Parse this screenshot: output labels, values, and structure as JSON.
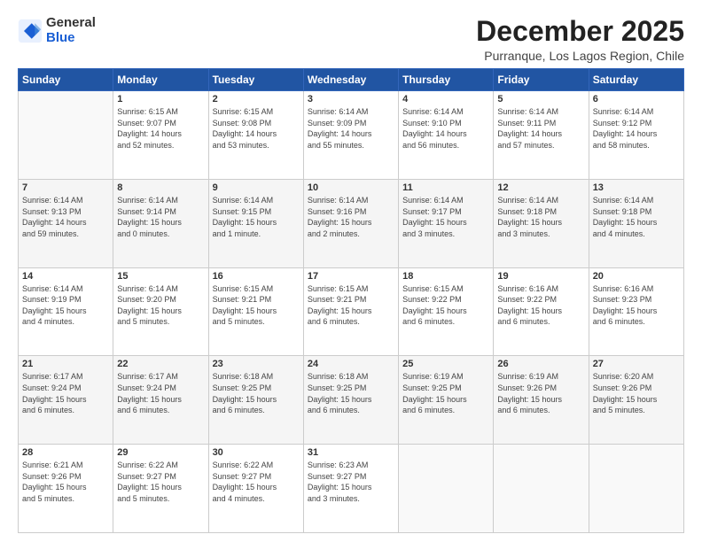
{
  "logo": {
    "general": "General",
    "blue": "Blue"
  },
  "header": {
    "month": "December 2025",
    "location": "Purranque, Los Lagos Region, Chile"
  },
  "weekdays": [
    "Sunday",
    "Monday",
    "Tuesday",
    "Wednesday",
    "Thursday",
    "Friday",
    "Saturday"
  ],
  "weeks": [
    [
      {
        "day": "",
        "detail": ""
      },
      {
        "day": "1",
        "detail": "Sunrise: 6:15 AM\nSunset: 9:07 PM\nDaylight: 14 hours\nand 52 minutes."
      },
      {
        "day": "2",
        "detail": "Sunrise: 6:15 AM\nSunset: 9:08 PM\nDaylight: 14 hours\nand 53 minutes."
      },
      {
        "day": "3",
        "detail": "Sunrise: 6:14 AM\nSunset: 9:09 PM\nDaylight: 14 hours\nand 55 minutes."
      },
      {
        "day": "4",
        "detail": "Sunrise: 6:14 AM\nSunset: 9:10 PM\nDaylight: 14 hours\nand 56 minutes."
      },
      {
        "day": "5",
        "detail": "Sunrise: 6:14 AM\nSunset: 9:11 PM\nDaylight: 14 hours\nand 57 minutes."
      },
      {
        "day": "6",
        "detail": "Sunrise: 6:14 AM\nSunset: 9:12 PM\nDaylight: 14 hours\nand 58 minutes."
      }
    ],
    [
      {
        "day": "7",
        "detail": "Sunrise: 6:14 AM\nSunset: 9:13 PM\nDaylight: 14 hours\nand 59 minutes."
      },
      {
        "day": "8",
        "detail": "Sunrise: 6:14 AM\nSunset: 9:14 PM\nDaylight: 15 hours\nand 0 minutes."
      },
      {
        "day": "9",
        "detail": "Sunrise: 6:14 AM\nSunset: 9:15 PM\nDaylight: 15 hours\nand 1 minute."
      },
      {
        "day": "10",
        "detail": "Sunrise: 6:14 AM\nSunset: 9:16 PM\nDaylight: 15 hours\nand 2 minutes."
      },
      {
        "day": "11",
        "detail": "Sunrise: 6:14 AM\nSunset: 9:17 PM\nDaylight: 15 hours\nand 3 minutes."
      },
      {
        "day": "12",
        "detail": "Sunrise: 6:14 AM\nSunset: 9:18 PM\nDaylight: 15 hours\nand 3 minutes."
      },
      {
        "day": "13",
        "detail": "Sunrise: 6:14 AM\nSunset: 9:18 PM\nDaylight: 15 hours\nand 4 minutes."
      }
    ],
    [
      {
        "day": "14",
        "detail": "Sunrise: 6:14 AM\nSunset: 9:19 PM\nDaylight: 15 hours\nand 4 minutes."
      },
      {
        "day": "15",
        "detail": "Sunrise: 6:14 AM\nSunset: 9:20 PM\nDaylight: 15 hours\nand 5 minutes."
      },
      {
        "day": "16",
        "detail": "Sunrise: 6:15 AM\nSunset: 9:21 PM\nDaylight: 15 hours\nand 5 minutes."
      },
      {
        "day": "17",
        "detail": "Sunrise: 6:15 AM\nSunset: 9:21 PM\nDaylight: 15 hours\nand 6 minutes."
      },
      {
        "day": "18",
        "detail": "Sunrise: 6:15 AM\nSunset: 9:22 PM\nDaylight: 15 hours\nand 6 minutes."
      },
      {
        "day": "19",
        "detail": "Sunrise: 6:16 AM\nSunset: 9:22 PM\nDaylight: 15 hours\nand 6 minutes."
      },
      {
        "day": "20",
        "detail": "Sunrise: 6:16 AM\nSunset: 9:23 PM\nDaylight: 15 hours\nand 6 minutes."
      }
    ],
    [
      {
        "day": "21",
        "detail": "Sunrise: 6:17 AM\nSunset: 9:24 PM\nDaylight: 15 hours\nand 6 minutes."
      },
      {
        "day": "22",
        "detail": "Sunrise: 6:17 AM\nSunset: 9:24 PM\nDaylight: 15 hours\nand 6 minutes."
      },
      {
        "day": "23",
        "detail": "Sunrise: 6:18 AM\nSunset: 9:25 PM\nDaylight: 15 hours\nand 6 minutes."
      },
      {
        "day": "24",
        "detail": "Sunrise: 6:18 AM\nSunset: 9:25 PM\nDaylight: 15 hours\nand 6 minutes."
      },
      {
        "day": "25",
        "detail": "Sunrise: 6:19 AM\nSunset: 9:25 PM\nDaylight: 15 hours\nand 6 minutes."
      },
      {
        "day": "26",
        "detail": "Sunrise: 6:19 AM\nSunset: 9:26 PM\nDaylight: 15 hours\nand 6 minutes."
      },
      {
        "day": "27",
        "detail": "Sunrise: 6:20 AM\nSunset: 9:26 PM\nDaylight: 15 hours\nand 5 minutes."
      }
    ],
    [
      {
        "day": "28",
        "detail": "Sunrise: 6:21 AM\nSunset: 9:26 PM\nDaylight: 15 hours\nand 5 minutes."
      },
      {
        "day": "29",
        "detail": "Sunrise: 6:22 AM\nSunset: 9:27 PM\nDaylight: 15 hours\nand 5 minutes."
      },
      {
        "day": "30",
        "detail": "Sunrise: 6:22 AM\nSunset: 9:27 PM\nDaylight: 15 hours\nand 4 minutes."
      },
      {
        "day": "31",
        "detail": "Sunrise: 6:23 AM\nSunset: 9:27 PM\nDaylight: 15 hours\nand 3 minutes."
      },
      {
        "day": "",
        "detail": ""
      },
      {
        "day": "",
        "detail": ""
      },
      {
        "day": "",
        "detail": ""
      }
    ]
  ]
}
